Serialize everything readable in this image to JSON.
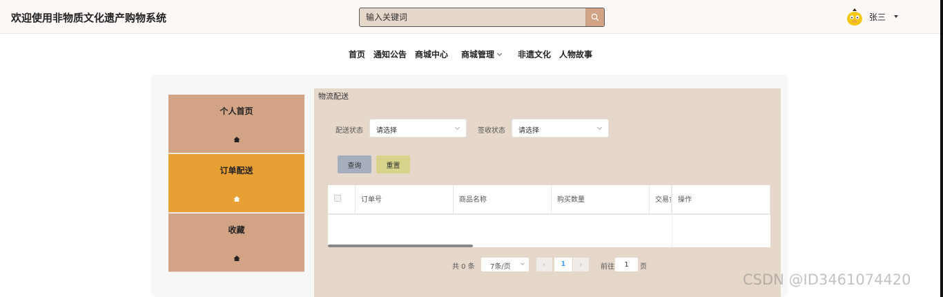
{
  "header": {
    "site_title": "欢迎使用非物质文化遗产购物系统",
    "search_placeholder": "输入关键词",
    "user_name": "张三"
  },
  "nav": {
    "items": [
      {
        "label": "首页"
      },
      {
        "label": "通知公告"
      },
      {
        "label": "商城中心"
      },
      {
        "label": "商城管理"
      },
      {
        "label": "非遗文化"
      },
      {
        "label": "人物故事"
      }
    ]
  },
  "sidebar": {
    "items": [
      {
        "label": "个人首页",
        "active": false
      },
      {
        "label": "订单配送",
        "active": true
      },
      {
        "label": "收藏",
        "active": false
      }
    ]
  },
  "content": {
    "title": "物流配送",
    "filters": [
      {
        "label": "配送状态",
        "placeholder": "请选择"
      },
      {
        "label": "签收状态",
        "placeholder": "请选择"
      }
    ],
    "query_label": "查询",
    "reset_label": "重置",
    "table": {
      "columns": [
        "订单号",
        "商品名称",
        "购买数量",
        "交易金额",
        "操作"
      ],
      "rows": []
    },
    "pagination": {
      "total_text": "共 0 条",
      "page_size": "7条/页",
      "current_page": "1",
      "goto_label": "前往",
      "goto_value": "1",
      "page_suffix": "页",
      "prev_symbol": "‹",
      "next_symbol": "›"
    }
  },
  "watermark": "CSDN @ID3461074420",
  "colors": {
    "sidebar": "#d3a385",
    "sidebar_active": "#e89f33",
    "content_bg": "#e5d7ca",
    "query_btn": "#a6adbe",
    "reset_btn": "#d5d48a",
    "page_active": "#409eff"
  }
}
